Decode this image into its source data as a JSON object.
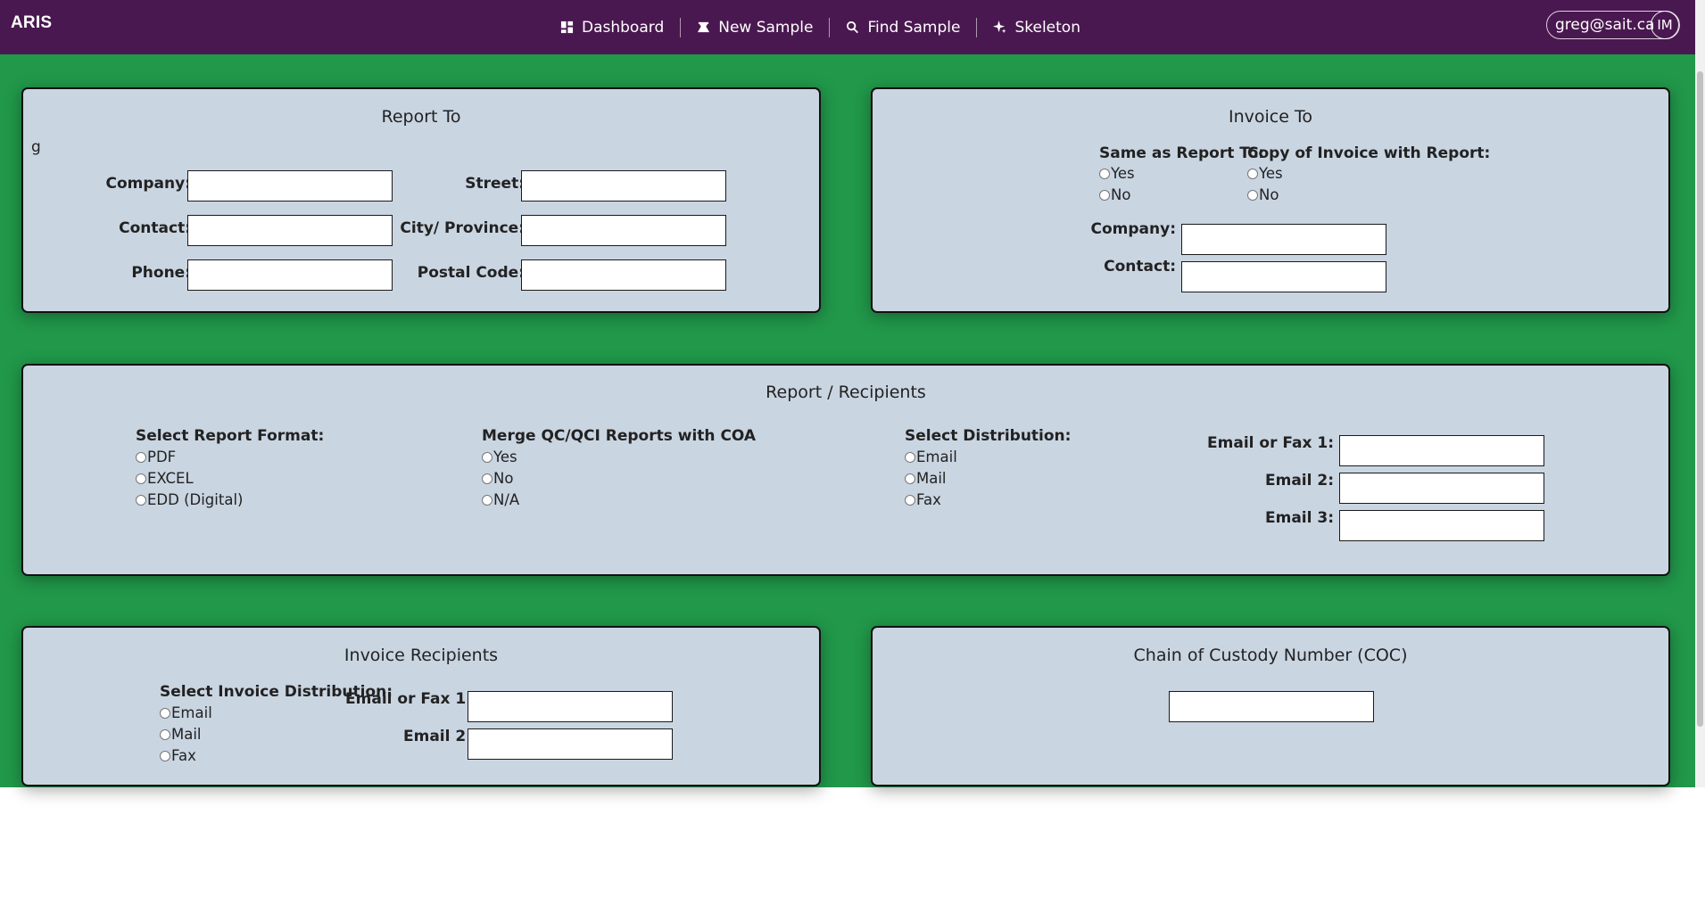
{
  "app": {
    "brand": "ARIS"
  },
  "nav": {
    "items": [
      {
        "label": "Dashboard",
        "icon": "dashboard-icon"
      },
      {
        "label": "New Sample",
        "icon": "flask-icon"
      },
      {
        "label": "Find Sample",
        "icon": "search-icon"
      },
      {
        "label": "Skeleton",
        "icon": "sparkle-icon"
      }
    ]
  },
  "user": {
    "email": "greg@sait.ca",
    "initials": "IM"
  },
  "colors": {
    "header": "#4a1850",
    "background": "#21984a",
    "card": "#cad5e2"
  },
  "report_to": {
    "title": "Report To",
    "stray_text": "g",
    "company_label": "Company:",
    "contact_label": "Contact:",
    "phone_label": "Phone:",
    "street_label": "Street:",
    "city_label": "City/ Province:",
    "postal_label": "Postal Code:"
  },
  "invoice_to": {
    "title": "Invoice To",
    "same_as_label": "Same as Report To:",
    "copy_label": "Copy of Invoice with Report:",
    "yes": "Yes",
    "no": "No",
    "company_label": "Company:",
    "contact_label": "Contact:"
  },
  "report_recipients": {
    "title": "Report / Recipients",
    "format_label": "Select Report Format:",
    "formats": [
      "PDF",
      "EXCEL",
      "EDD (Digital)"
    ],
    "merge_label": "Merge QC/QCI Reports with COA",
    "merge_options": [
      "Yes",
      "No",
      "N/A"
    ],
    "distribution_label": "Select Distribution:",
    "distribution_options": [
      "Email",
      "Mail",
      "Fax"
    ],
    "email1_label": "Email or Fax 1:",
    "email2_label": "Email 2:",
    "email3_label": "Email 3:"
  },
  "invoice_recipients": {
    "title": "Invoice Recipients",
    "distribution_label": "Select Invoice Distribution:",
    "distribution_options": [
      "Email",
      "Mail",
      "Fax"
    ],
    "email1_label": "Email or Fax 1:",
    "email2_label": "Email 2:"
  },
  "coc": {
    "title": "Chain of Custody Number (COC)"
  }
}
